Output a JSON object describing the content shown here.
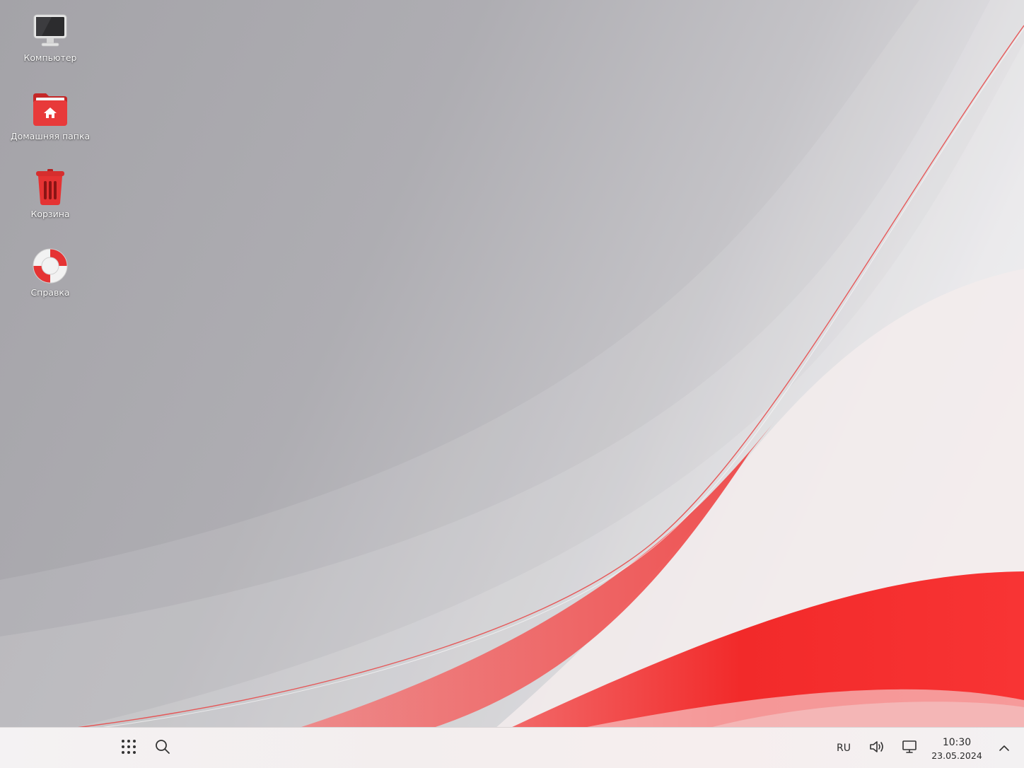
{
  "desktop": {
    "icons": [
      {
        "label": "Компьютер",
        "icon": "computer-icon"
      },
      {
        "label": "Домашняя папка",
        "icon": "home-folder-icon"
      },
      {
        "label": "Корзина",
        "icon": "trash-icon"
      },
      {
        "label": "Справка",
        "icon": "help-lifebuoy-icon"
      }
    ]
  },
  "taskbar": {
    "app_menu_icon": "app-grid-icon",
    "search_icon": "search-icon",
    "language": "RU",
    "volume_icon": "volume-icon",
    "display_icon": "display-icon",
    "time": "10:30",
    "date": "23.05.2024",
    "tray_expand_icon": "chevron-up-icon"
  },
  "colors": {
    "accent_red": "#f22a2a",
    "taskbar_bg": "#f4f1f2",
    "wallpaper_gray": "#a9a8ad"
  }
}
